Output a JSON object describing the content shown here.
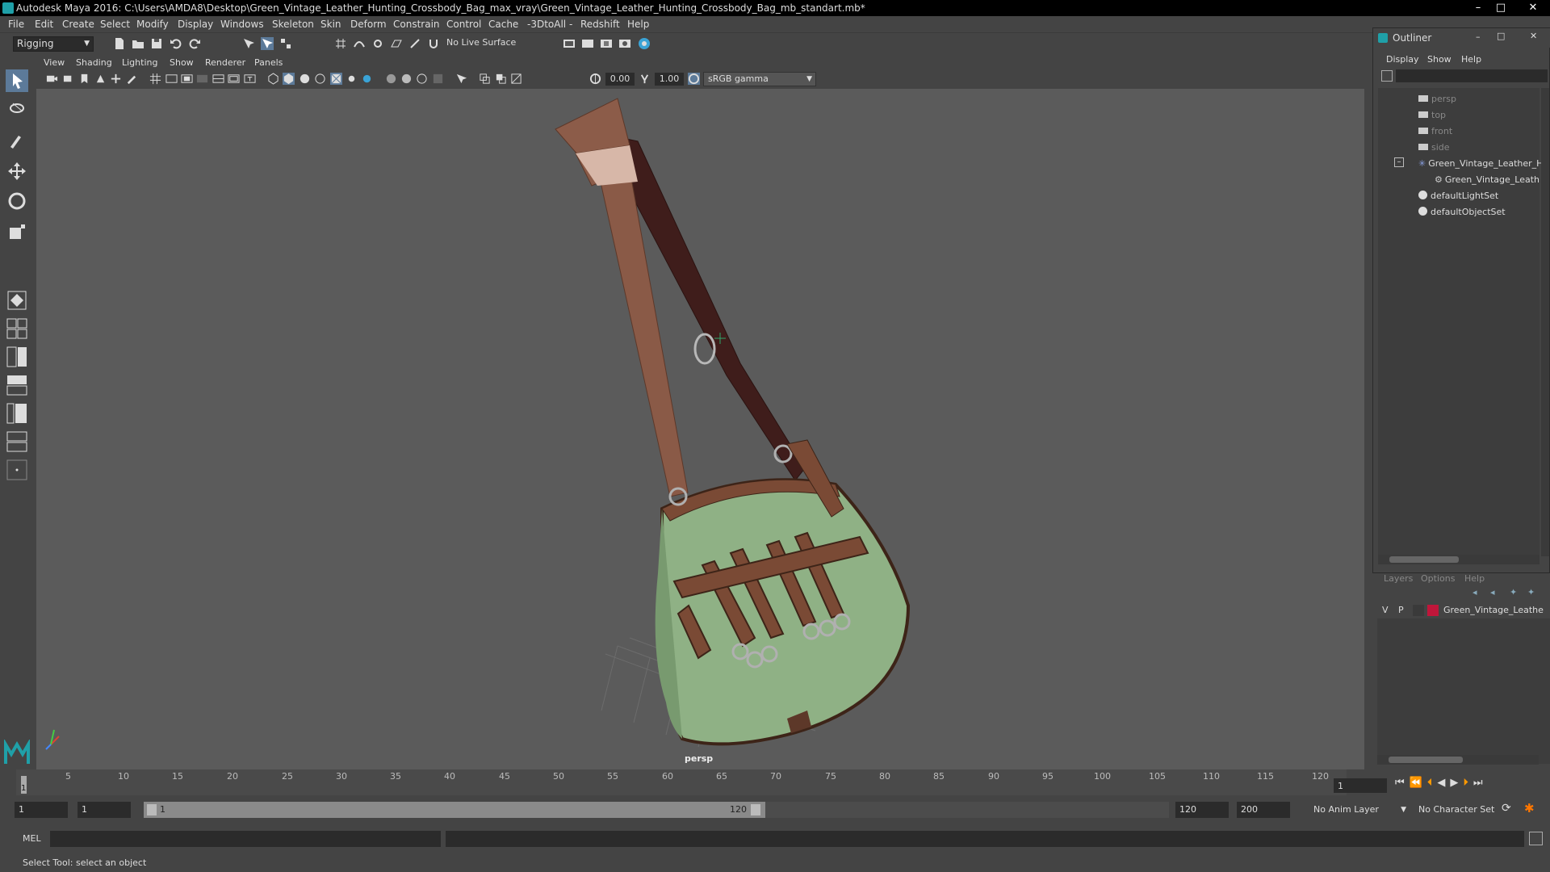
{
  "window": {
    "title": "Autodesk Maya 2016: C:\\Users\\AMDA8\\Desktop\\Green_Vintage_Leather_Hunting_Crossbody_Bag_max_vray\\Green_Vintage_Leather_Hunting_Crossbody_Bag_mb_standart.mb*",
    "minimize": "–",
    "maximize": "□",
    "close": "✕"
  },
  "menu": [
    "File",
    "Edit",
    "Create",
    "Select",
    "Modify",
    "Display",
    "Windows",
    "Skeleton",
    "Skin",
    "Deform",
    "Constrain",
    "Control",
    "Cache",
    "-3DtoAll -",
    "Redshift",
    "Help"
  ],
  "toolbar": {
    "mode": "Rigging",
    "live_surface": "No Live Surface"
  },
  "panel_menu": [
    "View",
    "Shading",
    "Lighting",
    "Show",
    "Renderer",
    "Panels"
  ],
  "view_toolbar": {
    "exposure": "0.00",
    "gamma": "1.00",
    "color_space": "sRGB gamma"
  },
  "viewport": {
    "camera_label": "persp"
  },
  "outliner": {
    "title": "Outliner",
    "menu": [
      "Display",
      "Show",
      "Help"
    ],
    "items": [
      {
        "label": "persp",
        "icon": "camera-icon",
        "dim": true
      },
      {
        "label": "top",
        "icon": "camera-icon",
        "dim": true
      },
      {
        "label": "front",
        "icon": "camera-icon",
        "dim": true
      },
      {
        "label": "side",
        "icon": "camera-icon",
        "dim": true
      },
      {
        "label": "Green_Vintage_Leather_H",
        "icon": "group-icon",
        "dim": false
      },
      {
        "label": "Green_Vintage_Leath",
        "icon": "mesh-icon",
        "dim": false
      },
      {
        "label": "defaultLightSet",
        "icon": "set-icon",
        "dim": false
      },
      {
        "label": "defaultObjectSet",
        "icon": "set-icon",
        "dim": false
      }
    ]
  },
  "layers": {
    "menu": [
      "Layers",
      "Options",
      "Help"
    ],
    "row": {
      "v": "V",
      "p": "P",
      "name": "Green_Vintage_Leathe",
      "color": "#c0163a"
    }
  },
  "timeline": {
    "ticks": [
      "5",
      "10",
      "15",
      "20",
      "25",
      "30",
      "35",
      "40",
      "45",
      "50",
      "55",
      "60",
      "65",
      "70",
      "75",
      "80",
      "85",
      "90",
      "95",
      "100",
      "105",
      "110",
      "115",
      "120"
    ],
    "current_marker": "1",
    "current_frame": "1"
  },
  "range": {
    "start": "1",
    "playback_start": "1",
    "slider_start": "1",
    "slider_end": "120",
    "playback_end": "120",
    "end": "200",
    "anim_layer": "No Anim Layer",
    "character_set": "No Character Set"
  },
  "command": {
    "lang": "MEL"
  },
  "help_line": "Select Tool: select an object",
  "colors": {
    "viewport_bg": "#5b5b5b",
    "ui_bg": "#444444",
    "bag_green": "#8fb185",
    "leather": "#7a4a35"
  }
}
